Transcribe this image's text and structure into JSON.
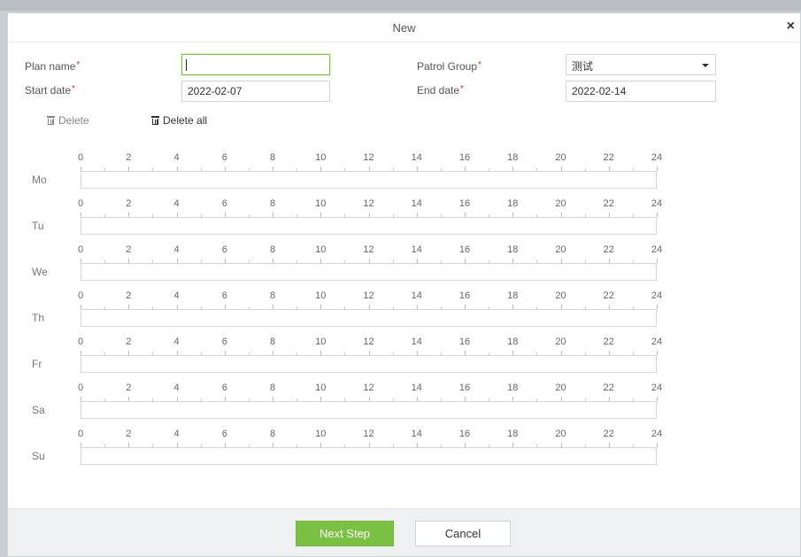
{
  "dialog": {
    "title": "New",
    "close_symbol": "×"
  },
  "form": {
    "plan_name": {
      "label": "Plan name",
      "value": ""
    },
    "patrol_group": {
      "label": "Patrol Group",
      "value": "测试"
    },
    "start_date": {
      "label": "Start date",
      "value": "2022-02-07"
    },
    "end_date": {
      "label": "End date",
      "value": "2022-02-14"
    },
    "required_mark": "*"
  },
  "toolbar": {
    "delete_label": "Delete",
    "delete_all_label": "Delete all"
  },
  "schedule": {
    "hour_ticks": [
      "0",
      "2",
      "4",
      "6",
      "8",
      "10",
      "12",
      "14",
      "16",
      "18",
      "20",
      "22",
      "24"
    ],
    "days": [
      "Mo",
      "Tu",
      "We",
      "Th",
      "Fr",
      "Sa",
      "Su"
    ]
  },
  "footer": {
    "next_label": "Next Step",
    "cancel_label": "Cancel"
  },
  "colors": {
    "accent": "#7ac143",
    "required": "#e0261b"
  }
}
